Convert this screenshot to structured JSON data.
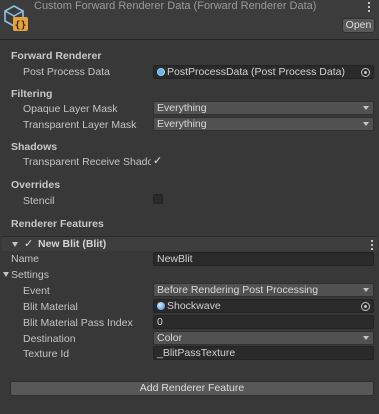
{
  "header": {
    "title": "Custom Forward Renderer Data (Forward Renderer Data)",
    "open_label": "Open",
    "icon": "scriptable-object-icon",
    "menu_icon": "kebab-menu-icon"
  },
  "forward_renderer": {
    "title": "Forward Renderer",
    "post_process_label": "Post Process Data",
    "post_process_value": "PostProcessData (Post Process Data)"
  },
  "filtering": {
    "title": "Filtering",
    "opaque_label": "Opaque Layer Mask",
    "opaque_value": "Everything",
    "transparent_label": "Transparent Layer Mask",
    "transparent_value": "Everything"
  },
  "shadows": {
    "title": "Shadows",
    "receive_label": "Transparent Receive Shadows",
    "receive_checked": true
  },
  "overrides": {
    "title": "Overrides",
    "stencil_label": "Stencil",
    "stencil_checked": false
  },
  "renderer_features": {
    "title": "Renderer Features",
    "feature": {
      "title": "New Blit (Blit)",
      "enabled": true,
      "name_label": "Name",
      "name_value": "NewBlit",
      "settings_label": "Settings",
      "event_label": "Event",
      "event_value": "Before Rendering Post Processing",
      "material_label": "Blit Material",
      "material_value": "Shockwave",
      "pass_index_label": "Blit Material Pass Index",
      "pass_index_value": "0",
      "destination_label": "Destination",
      "destination_value": "Color",
      "texture_id_label": "Texture Id",
      "texture_id_value": "_BlitPassTexture"
    },
    "add_label": "Add Renderer Feature"
  },
  "colors": {
    "background": "#383838",
    "field": "#2a2a2a",
    "dropdown": "#515151",
    "icon_blue": "#6cb4e4",
    "icon_orange": "#e8a23a"
  }
}
